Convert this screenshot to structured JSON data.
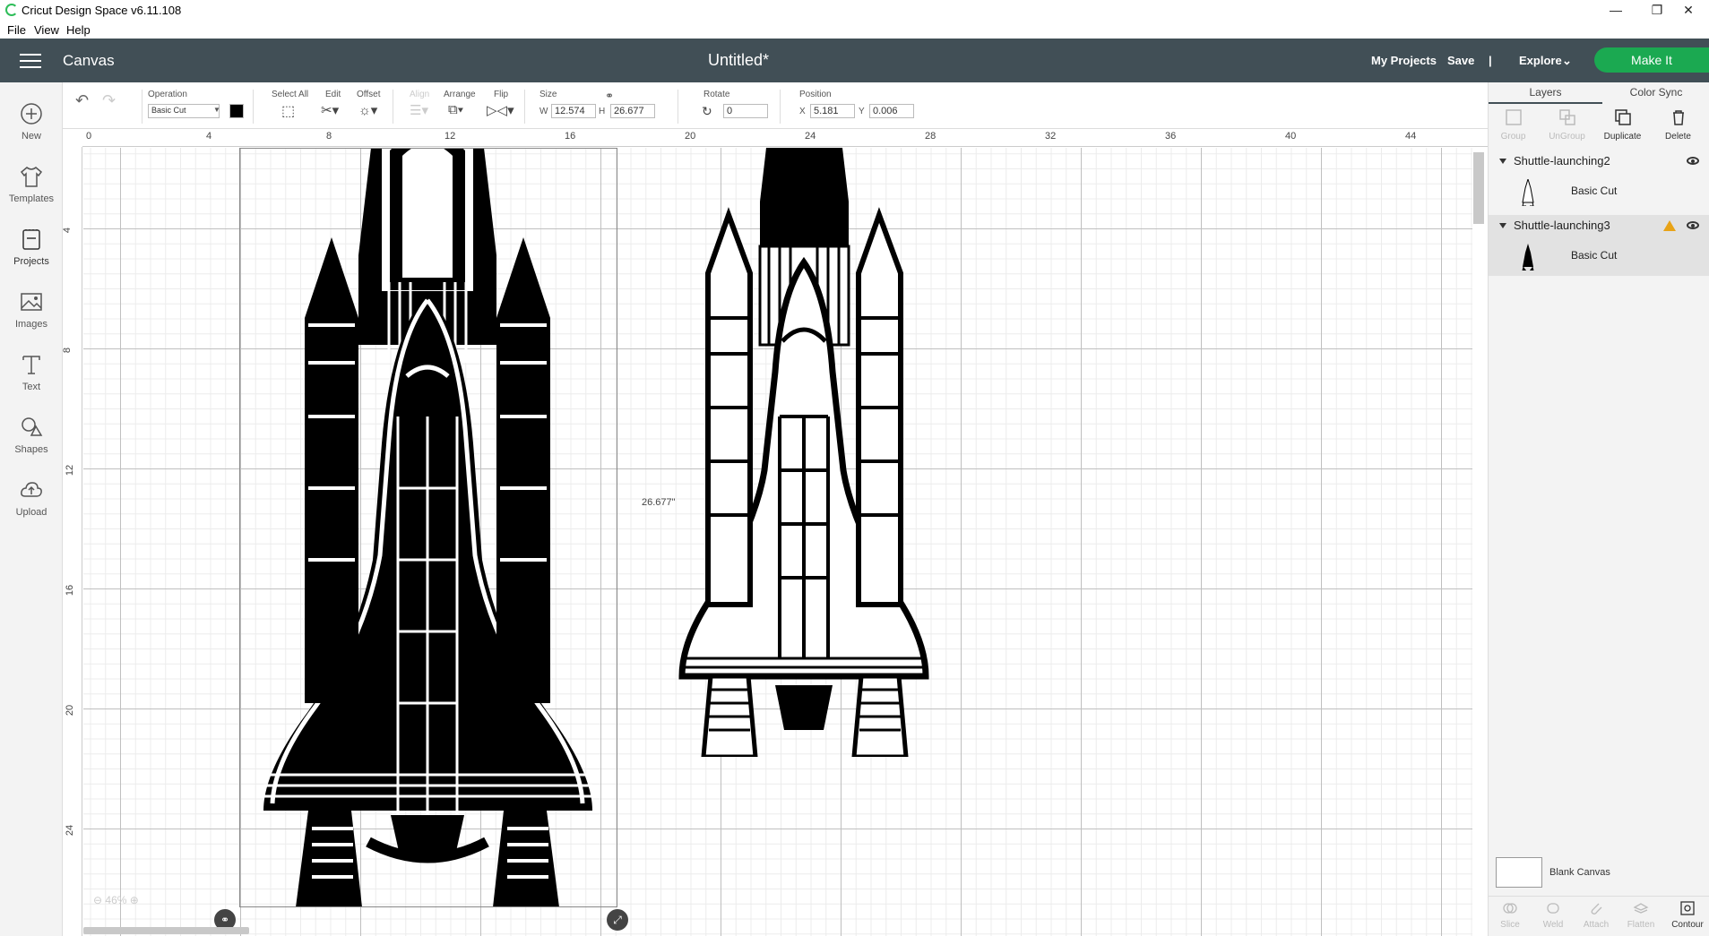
{
  "window": {
    "title": "Cricut Design Space  v6.11.108",
    "controls": [
      "minimize",
      "restore",
      "close"
    ]
  },
  "menubar": {
    "items": [
      "File",
      "View",
      "Help"
    ]
  },
  "header": {
    "section": "Canvas",
    "doc_title": "Untitled*",
    "my_projects": "My Projects",
    "save": "Save",
    "divider": "|",
    "explore": "Explore",
    "make_it": "Make It"
  },
  "leftrail": {
    "items": [
      {
        "label": "New",
        "icon": "plus-circle-icon"
      },
      {
        "label": "Templates",
        "icon": "tshirt-icon"
      },
      {
        "label": "Projects",
        "icon": "projects-icon"
      },
      {
        "label": "Images",
        "icon": "image-icon"
      },
      {
        "label": "Text",
        "icon": "text-icon"
      },
      {
        "label": "Shapes",
        "icon": "shapes-icon"
      },
      {
        "label": "Upload",
        "icon": "upload-cloud-icon"
      }
    ]
  },
  "toolbar": {
    "operation_label": "Operation",
    "operation_value": "Basic Cut",
    "operation_color": "#000000",
    "select_all": "Select All",
    "edit": "Edit",
    "offset": "Offset",
    "align": "Align",
    "arrange": "Arrange",
    "flip": "Flip",
    "size_label": "Size",
    "w_label": "W",
    "w_value": "12.574",
    "h_label": "H",
    "h_value": "26.677",
    "rotate_label": "Rotate",
    "rotate_value": "0",
    "position_label": "Position",
    "x_label": "X",
    "x_value": "5.181",
    "y_label": "Y",
    "y_value": "0.006"
  },
  "ruler": {
    "h_ticks": [
      "0",
      "4",
      "8",
      "12",
      "16",
      "20",
      "24",
      "28",
      "32",
      "36",
      "40",
      "44"
    ],
    "v_ticks": [
      "4",
      "8",
      "12",
      "16",
      "20",
      "24"
    ]
  },
  "canvas": {
    "dimension_label": "26.677\"",
    "zoom": "46%"
  },
  "layers_panel": {
    "tabs": [
      "Layers",
      "Color Sync"
    ],
    "tools": [
      "Group",
      "UnGroup",
      "Duplicate",
      "Delete"
    ],
    "groups": [
      {
        "name": "Shuttle-launching2",
        "item": "Basic Cut",
        "warning": false
      },
      {
        "name": "Shuttle-launching3",
        "item": "Basic Cut",
        "warning": true
      }
    ],
    "blank_canvas": "Blank Canvas",
    "bottom_tools": [
      "Slice",
      "Weld",
      "Attach",
      "Flatten",
      "Contour"
    ]
  }
}
